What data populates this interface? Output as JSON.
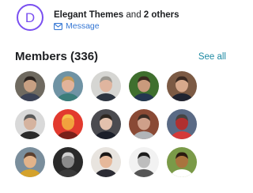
{
  "group": {
    "name": "Elegant Themes",
    "suffix": " and ",
    "others": "2 others",
    "message_label": "Message",
    "logo_letter": "D"
  },
  "members": {
    "title": "Members (336)",
    "see_all": "See all",
    "avatars": [
      {
        "bg": "#6f6a60",
        "skin": "#c8a083",
        "shirt": "#3b4256",
        "hair": "#2b2420"
      },
      {
        "bg": "#6f93a4",
        "skin": "#e2b39a",
        "shirt": "#3b7d7a",
        "hair": "#c39a5a"
      },
      {
        "bg": "#d6d6d3",
        "skin": "#e0b59f",
        "shirt": "#2d3440",
        "hair": "#9a9790"
      },
      {
        "bg": "#3f6f2e",
        "skin": "#c99a7c",
        "shirt": "#243650",
        "hair": "#3a2a20"
      },
      {
        "bg": "#7c5a44",
        "skin": "#d8a98c",
        "shirt": "#1f2330",
        "hair": "#3b2a22"
      },
      {
        "bg": "#d9d9d9",
        "skin": "#d5b39f",
        "shirt": "#2b2b2b",
        "hair": "#5a5a5a"
      },
      {
        "bg": "#e23a2e",
        "skin": "#f2a23e",
        "shirt": "#7a1f1a",
        "hair": "#f5c04a"
      },
      {
        "bg": "#4b4b50",
        "skin": "#e3c1ad",
        "shirt": "#1b1f2a",
        "hair": "#2d2620"
      },
      {
        "bg": "#8a4a35",
        "skin": "#cfa08a",
        "shirt": "#b1b4b7",
        "hair": "#3a2c24"
      },
      {
        "bg": "#5a6a85",
        "skin": "#b03030",
        "shirt": "#d53a3a",
        "hair": "#444444"
      },
      {
        "bg": "#7a8e9c",
        "skin": "#e2b38a",
        "shirt": "#d4a22c",
        "hair": "#5a4030"
      },
      {
        "bg": "#2a2a2a",
        "skin": "#8a8a8a",
        "shirt": "#3a3a3a",
        "hair": "#cfcfcf"
      },
      {
        "bg": "#e8e4df",
        "skin": "#e6b89a",
        "shirt": "#2b2b33",
        "hair": "#1a1716"
      },
      {
        "bg": "#f2f2f2",
        "skin": "#bdbdbd",
        "shirt": "#555555",
        "hair": "#1c1c1c"
      },
      {
        "bg": "#7a9a48",
        "skin": "#a9743e",
        "shirt": "#ffffff",
        "hair": "#2a1a10"
      }
    ]
  },
  "colors": {
    "logo_purple": "#7a4ff0",
    "link_blue": "#3577d4",
    "see_all_teal": "#1e8aa3"
  }
}
